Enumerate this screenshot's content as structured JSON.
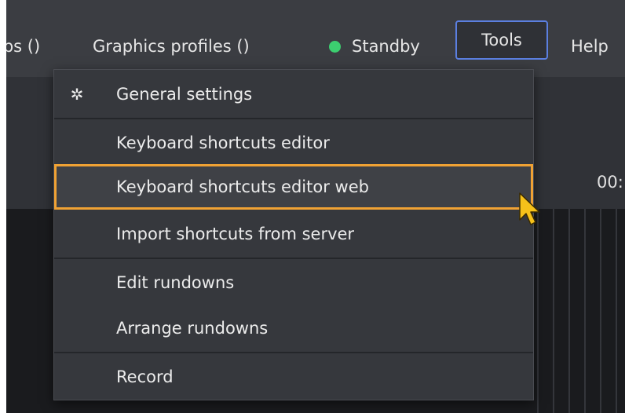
{
  "topbar": {
    "groups_label": "ıps ()",
    "graphics_profiles_label": "Graphics profiles ()",
    "status_label": "Standby",
    "status_color": "#3ccf70",
    "tools_label": "Tools",
    "help_label": "Help"
  },
  "background": {
    "timecode": "00:"
  },
  "menu": {
    "items": [
      {
        "label": "General settings",
        "icon": "gear-icon"
      },
      {
        "label": "Keyboard shortcuts editor"
      },
      {
        "label": "Keyboard shortcuts editor web",
        "highlighted": true
      },
      {
        "label": "Import shortcuts from server"
      },
      {
        "label": "Edit rundowns"
      },
      {
        "label": "Arrange rundowns"
      },
      {
        "label": "Record"
      }
    ]
  },
  "colors": {
    "accent_border": "#5b7fe0",
    "highlight_outline": "#f0a234",
    "cursor": "#f6c11a"
  }
}
